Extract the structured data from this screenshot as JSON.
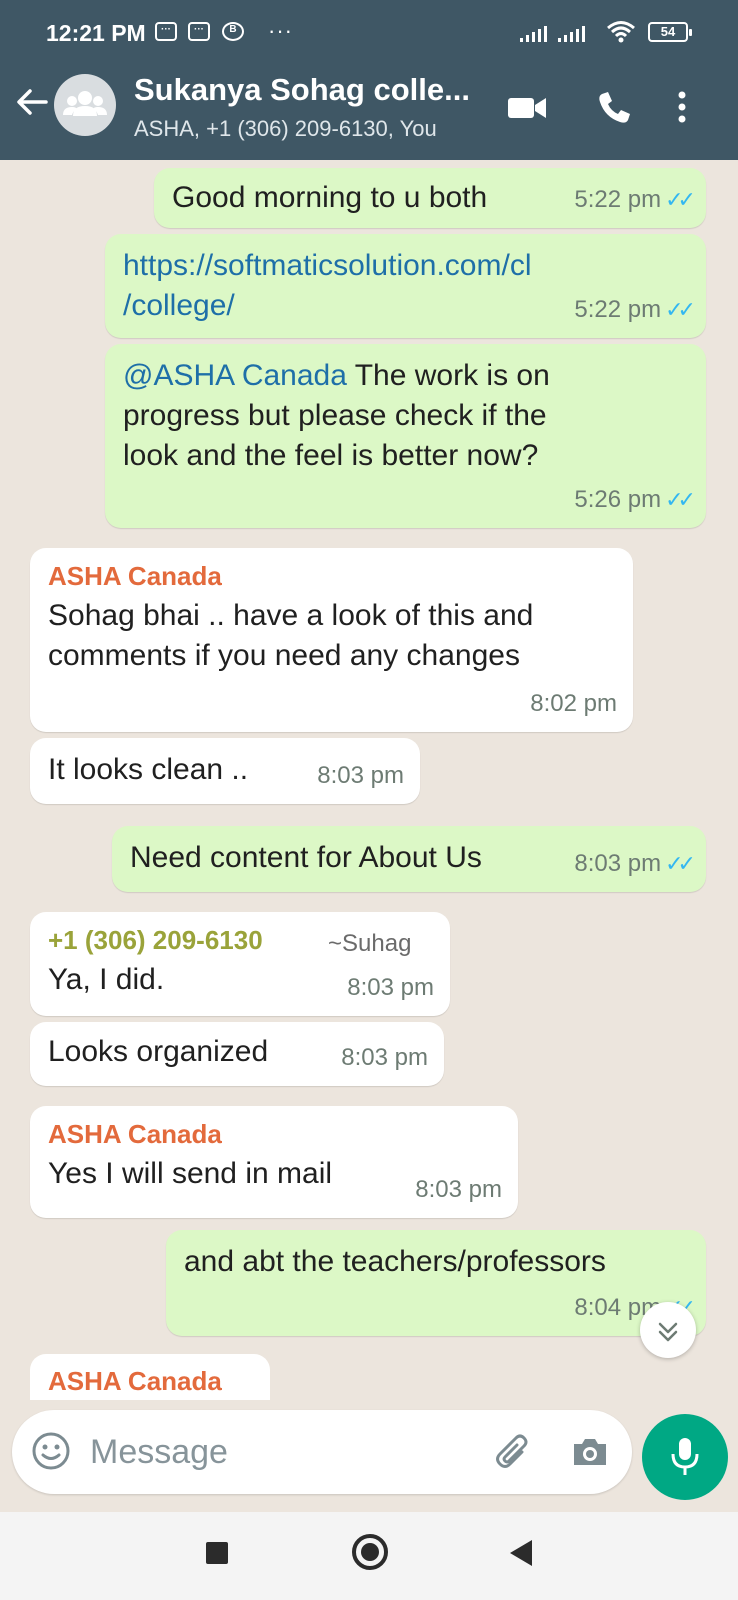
{
  "status_bar": {
    "time": "12:21 PM",
    "icons": [
      "message-icon",
      "message-icon",
      "b-icon"
    ],
    "more": "···",
    "battery": "54"
  },
  "header": {
    "title": "Sukanya Sohag colle...",
    "subtitle": "ASHA, +1 (306) 209-6130, You",
    "icons": [
      "back-arrow-icon",
      "group-avatar-icon",
      "video-call-icon",
      "voice-call-icon",
      "more-vert-icon"
    ]
  },
  "messages": [
    {
      "dir": "out",
      "text": "Good morning to u both",
      "time": "5:22 pm",
      "ticks": "✓✓"
    },
    {
      "dir": "out",
      "text": "https://softmaticsolution.com/cl/college/",
      "line1": "https://softmaticsolution.com/cl",
      "line2": "/college/",
      "time": "5:22 pm",
      "ticks": "✓✓"
    },
    {
      "dir": "out",
      "mention": "@ASHA Canada",
      "text": " The work is on progress but please check if the look and the feel is better now?",
      "line1": " The work is on",
      "line2": "progress but please check if the",
      "line3": "look and the feel is better now?",
      "time": "5:26 pm",
      "ticks": "✓✓"
    },
    {
      "dir": "in",
      "sender": "ASHA Canada",
      "text": "Sohag bhai .. have a look of this and comments if you need any changes",
      "line1": "Sohag bhai .. have a look of this and",
      "line2": "comments if you need any changes",
      "time": "8:02 pm"
    },
    {
      "dir": "in",
      "text": "It looks clean ..",
      "time": "8:03 pm"
    },
    {
      "dir": "out",
      "text": "Need content for About Us",
      "time": "8:03 pm",
      "ticks": "✓✓"
    },
    {
      "dir": "in",
      "sender": "+1 (306) 209-6130",
      "sender_alias": "~Suhag",
      "text": "Ya, I did.",
      "time": "8:03 pm"
    },
    {
      "dir": "in",
      "text": "Looks organized",
      "time": "8:03 pm"
    },
    {
      "dir": "in",
      "sender": "ASHA Canada",
      "text": "Yes I will send in mail",
      "time": "8:03 pm"
    },
    {
      "dir": "out",
      "text": "and abt the teachers/professors",
      "time": "8:04 pm",
      "ticks": "✓✓"
    },
    {
      "dir": "in",
      "sender": "ASHA Canada",
      "partial": true
    }
  ],
  "scroll_down": "»",
  "composer": {
    "placeholder": "Message",
    "icons": [
      "emoji-icon",
      "attach-icon",
      "camera-icon",
      "mic-icon"
    ]
  },
  "colors": {
    "header_bg": "#3f5765",
    "chat_bg": "#ece5dd",
    "outgoing_bubble": "#dcf8c6",
    "incoming_bubble": "#ffffff",
    "sender_asha": "#e36a3c",
    "sender_phone": "#9aa33a",
    "read_ticks": "#34b7f1",
    "mic_button": "#00a884"
  }
}
